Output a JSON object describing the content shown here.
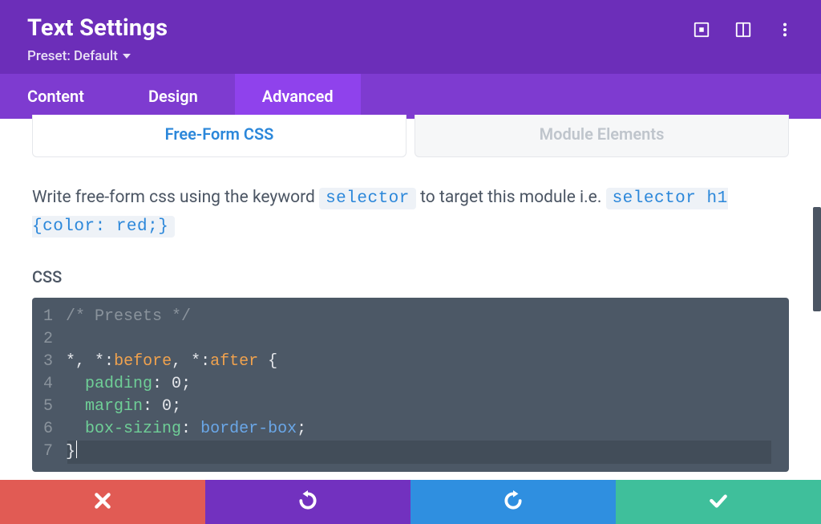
{
  "colors": {
    "header": "#6c2eb9",
    "tabs_bg": "#7e3bd0",
    "tab_active": "#8f42ec",
    "link": "#2b87da",
    "editor_bg": "#4c5866",
    "btn_close": "#e15b54",
    "btn_undo": "#7231bf",
    "btn_redo": "#2f8fe0",
    "btn_check": "#3fbf9b"
  },
  "header": {
    "title": "Text Settings",
    "preset_label": "Preset: Default"
  },
  "tabs": {
    "content": "Content",
    "design": "Design",
    "advanced": "Advanced",
    "active": "advanced"
  },
  "subtabs": {
    "freeform": "Free-Form CSS",
    "module": "Module Elements",
    "active": "freeform"
  },
  "description": {
    "pre": "Write free-form css using the keyword ",
    "kw1": "selector",
    "mid": " to target this module i.e. ",
    "kw2": "selector h1 {color: red;}"
  },
  "editor": {
    "label": "CSS",
    "lines": [
      {
        "n": "1",
        "type": "comment",
        "text": "/* Presets */"
      },
      {
        "n": "2",
        "type": "blank",
        "text": ""
      },
      {
        "n": "3",
        "type": "selector",
        "sel1": "*",
        "c1": ", ",
        "sel2": "*",
        "colon1": ":",
        "ps1": "before",
        "c2": ", ",
        "sel3": "*",
        "colon2": ":",
        "ps2": "after",
        "sp": " ",
        "brace": "{"
      },
      {
        "n": "4",
        "type": "decl",
        "prop": "padding",
        "colon": ": ",
        "val": "0",
        "semi": ";"
      },
      {
        "n": "5",
        "type": "decl",
        "prop": "margin",
        "colon": ": ",
        "val": "0",
        "semi": ";"
      },
      {
        "n": "6",
        "type": "decl",
        "prop": "box-sizing",
        "colon": ": ",
        "val": "border-box",
        "semi": ";"
      },
      {
        "n": "7",
        "type": "close",
        "brace": "}"
      }
    ]
  },
  "icons": {
    "expand": "expand-icon",
    "columns": "columns-icon",
    "more": "more-vertical-icon",
    "close": "close-icon",
    "undo": "undo-icon",
    "redo": "redo-icon",
    "check": "check-icon",
    "caret": "caret-down-icon"
  }
}
